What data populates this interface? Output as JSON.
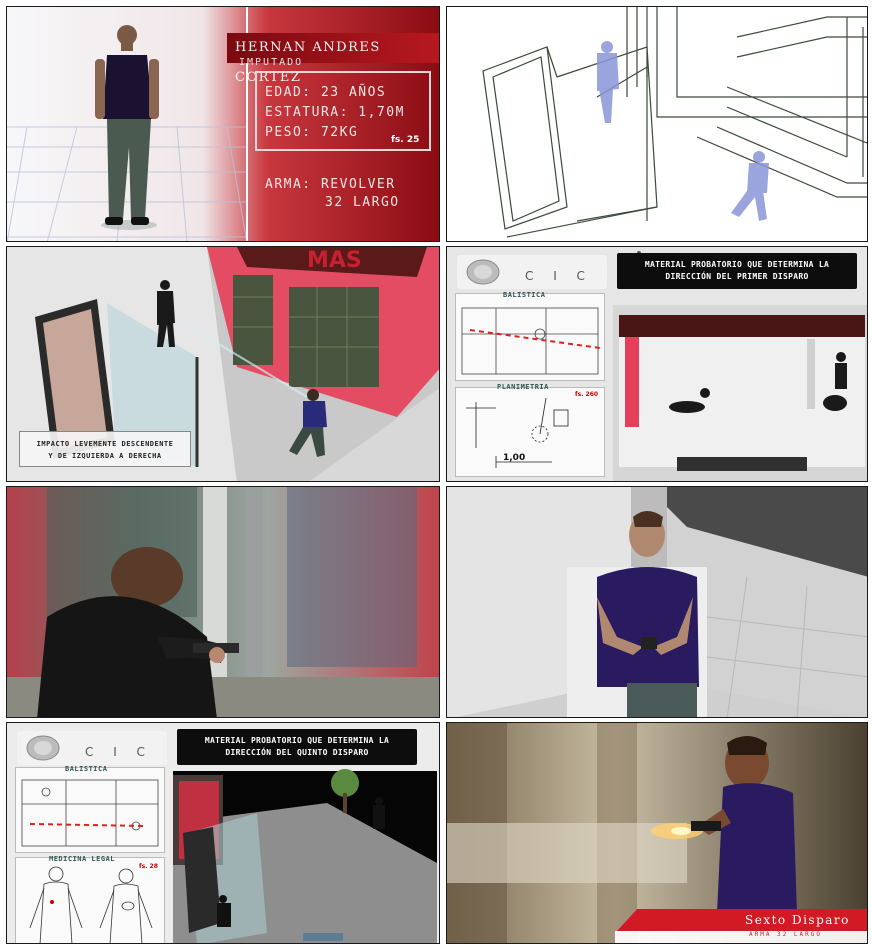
{
  "panel1": {
    "name": "Hernan Andres Cortez",
    "role": "Imputado",
    "age": "Edad: 23 años",
    "height": "Estatura: 1,70m",
    "weight": "Peso: 72kg",
    "fs": "fs. 25",
    "weapon_line1": "Arma: Revolver",
    "weapon_line2": "32 Largo"
  },
  "panel3": {
    "caption_line1": "Impacto levemente descendente",
    "caption_line2": "y de izquierda a derecha"
  },
  "panel4": {
    "logo_text": "C I C",
    "title_line1": "Material Probatorio que determina la",
    "title_line2": "dirección del primer disparo",
    "doc1_label": "Balistica",
    "doc2_label": "Planimetria",
    "fs_mark": "fs. 260",
    "measure": "1,00"
  },
  "panel7": {
    "logo_text": "C I C",
    "title_line1": "Material Probatorio que determina la",
    "title_line2": "dirección del quinto disparo",
    "doc1_label": "Balistica",
    "doc2_label": "Medicina Legal",
    "fs_mark": "fs. 28"
  },
  "panel8": {
    "title": "Sexto Disparo",
    "subtitle": "Arma 32 largo"
  },
  "colors": {
    "accent_red": "#b81820",
    "dark_red": "#7a0a10",
    "caption_red": "#d11a24"
  }
}
